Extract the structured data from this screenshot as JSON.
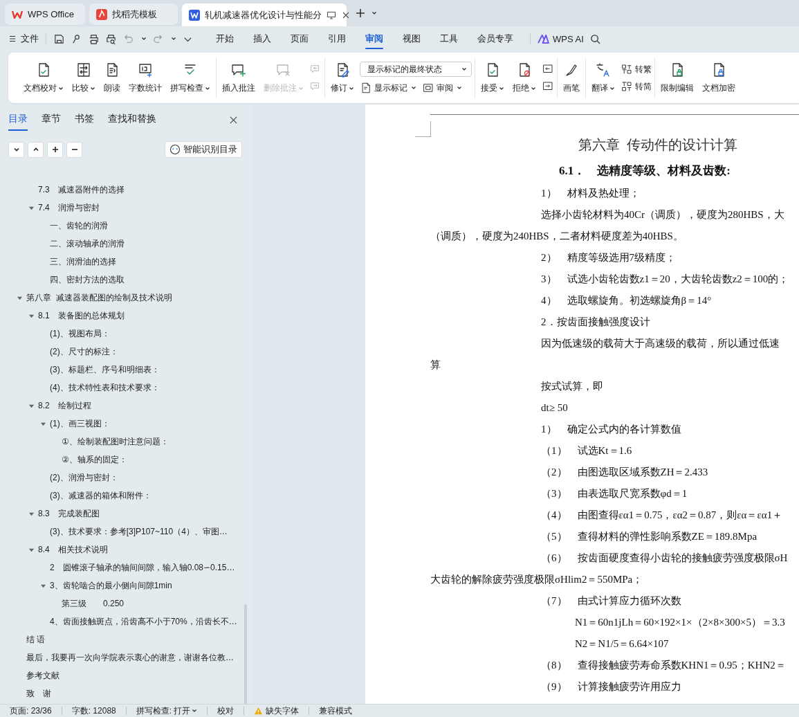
{
  "tabs": [
    {
      "title": "WPS Office",
      "selected": false,
      "kind": "home"
    },
    {
      "title": "找稻壳模板",
      "selected": false,
      "kind": "template"
    },
    {
      "title": "轧机减速器优化设计与性能分",
      "selected": true,
      "kind": "document"
    }
  ],
  "menu": {
    "file": "文件",
    "tabs": [
      {
        "label": "开始",
        "selected": false
      },
      {
        "label": "插入",
        "selected": false
      },
      {
        "label": "页面",
        "selected": false
      },
      {
        "label": "引用",
        "selected": false
      },
      {
        "label": "审阅",
        "selected": true
      },
      {
        "label": "视图",
        "selected": false
      },
      {
        "label": "工具",
        "selected": false
      },
      {
        "label": "会员专享",
        "selected": false
      }
    ],
    "ai": "WPS AI"
  },
  "ribbon": {
    "groups": [
      {
        "items": [
          {
            "kind": "large",
            "label": "文档校对",
            "dropdown": true,
            "disabled": false
          },
          {
            "kind": "large",
            "label": "比较",
            "dropdown": true,
            "disabled": false
          },
          {
            "kind": "large",
            "label": "朗读",
            "dropdown": false,
            "disabled": false
          },
          {
            "kind": "large",
            "label": "字数统计",
            "dropdown": false,
            "disabled": false
          },
          {
            "kind": "large",
            "label": "拼写检查",
            "dropdown": true,
            "disabled": false
          }
        ]
      },
      {
        "items": [
          {
            "kind": "large",
            "label": "插入批注",
            "dropdown": false,
            "disabled": false
          },
          {
            "kind": "large",
            "label": "删除批注",
            "dropdown": true,
            "disabled": true
          },
          {
            "kind": "stack",
            "rows": [
              [
                {
                  "kind": "icon",
                  "disabled": true
                }
              ],
              [
                {
                  "kind": "icon",
                  "disabled": true
                }
              ]
            ]
          }
        ]
      },
      {
        "items": [
          {
            "kind": "large",
            "label": "修订",
            "dropdown": true,
            "disabled": false
          },
          {
            "kind": "stack",
            "rows": [
              [
                {
                  "kind": "select",
                  "value": "显示标记的最终状态"
                }
              ],
              [
                {
                  "kind": "small",
                  "label": "显示标记",
                  "dropdown": true,
                  "disabled": false
                },
                {
                  "kind": "small",
                  "label": "审阅",
                  "dropdown": true,
                  "disabled": false
                }
              ]
            ]
          }
        ]
      },
      {
        "items": [
          {
            "kind": "large",
            "label": "接受",
            "dropdown": true,
            "disabled": false
          },
          {
            "kind": "large",
            "label": "拒绝",
            "dropdown": true,
            "disabled": false
          },
          {
            "kind": "stack",
            "rows": [
              [
                {
                  "kind": "icon",
                  "disabled": false
                }
              ],
              [
                {
                  "kind": "icon",
                  "disabled": false
                }
              ]
            ]
          }
        ]
      },
      {
        "items": [
          {
            "kind": "large",
            "label": "画笔",
            "dropdown": false,
            "disabled": false
          }
        ]
      },
      {
        "items": [
          {
            "kind": "large",
            "label": "翻译",
            "dropdown": true,
            "disabled": false
          },
          {
            "kind": "stack",
            "rows": [
              [
                {
                  "kind": "small",
                  "label": "转繁",
                  "dropdown": false,
                  "disabled": false
                }
              ],
              [
                {
                  "kind": "small",
                  "label": "转简",
                  "dropdown": false,
                  "disabled": false
                }
              ]
            ]
          }
        ]
      },
      {
        "items": [
          {
            "kind": "large",
            "label": "限制编辑",
            "dropdown": false,
            "disabled": false
          },
          {
            "kind": "large",
            "label": "文档加密",
            "dropdown": false,
            "disabled": false
          }
        ]
      }
    ]
  },
  "sidebar": {
    "tabs": [
      {
        "label": "目录",
        "selected": true
      },
      {
        "label": "章节",
        "selected": false
      },
      {
        "label": "书签",
        "selected": false
      },
      {
        "label": "查找和替换",
        "selected": false
      }
    ],
    "smart_button": "智能识别目录",
    "toc": {
      "partial_section": [
        {
          "text": "7.3　减速器附件的选择"
        },
        {
          "text": "7.4　润滑与密封",
          "expanded": true,
          "children": [
            {
              "text": "一、齿轮的润滑"
            },
            {
              "text": "二、滚动轴承的润滑"
            },
            {
              "text": "三、润滑油的选择"
            },
            {
              "text": "四、密封方法的选取"
            }
          ]
        }
      ],
      "items": [
        {
          "text": "第八章  减速器装配图的绘制及技术说明",
          "expanded": true,
          "children": [
            {
              "text": "8.1　装备图的总体规划",
              "expanded": true,
              "children": [
                {
                  "text": "(1)、视图布局："
                },
                {
                  "text": "(2)、尺寸的标注："
                },
                {
                  "text": "(3)、标题栏、序号和明细表："
                },
                {
                  "text": "(4)、技术特性表和技术要求："
                }
              ]
            },
            {
              "text": "8.2　绘制过程",
              "expanded": true,
              "children": [
                {
                  "text": "(1)、画三视图：",
                  "expanded": true,
                  "children": [
                    {
                      "text": "①、绘制装配图时注意问题："
                    },
                    {
                      "text": "②、轴系的固定："
                    }
                  ]
                },
                {
                  "text": "(2)、润滑与密封："
                },
                {
                  "text": "(3)、减速器的箱体和附件："
                }
              ]
            },
            {
              "text": "8.3　完成装配图",
              "expanded": true,
              "children": [
                {
                  "text": "(3)、技术要求：参考[3]P107~110（4）、审图…"
                }
              ]
            },
            {
              "text": "8.4　相关技术说明",
              "expanded": true,
              "children": [
                {
                  "text": "2　圆锥滚子轴承的轴间间隙，输入轴0.08∽0.15…"
                },
                {
                  "text": "3、齿轮啮合的最小侧向间隙1min",
                  "expanded": true,
                  "children": [
                    {
                      "text": "第三级　　0.250"
                    }
                  ]
                },
                {
                  "text": "4、齿面接触斑点，沿齿高不小于70%，沿齿长不…"
                }
              ]
            }
          ]
        },
        {
          "text": "结 语"
        },
        {
          "text": "最后，我要再一次向学院表示衷心的谢意，谢谢各位教…"
        },
        {
          "text": "参考文献"
        },
        {
          "text": "致　谢"
        }
      ]
    }
  },
  "document": {
    "lines": [
      {
        "kind": "chapter-title",
        "text": "第六章  传动件的设计计算"
      },
      {
        "kind": "section-heading",
        "text": "6.1．　选精度等级、材料及齿数:"
      },
      {
        "kind": "body",
        "text": "1）　材料及热处理；"
      },
      {
        "kind": "body",
        "text": "选择小齿轮材料为40Cr（调质），硬度为280HBS，大"
      },
      {
        "kind": "continuation",
        "text": "（调质），硬度为240HBS，二者材料硬度差为40HBS。"
      },
      {
        "kind": "body",
        "text": "2）　精度等级选用7级精度；"
      },
      {
        "kind": "body",
        "text": "3）　试选小齿轮齿数z1＝20，大齿轮齿数z2＝100的；"
      },
      {
        "kind": "body",
        "text": "4）　选取螺旋角。初选螺旋角β＝14°"
      },
      {
        "kind": "body",
        "text": "2．按齿面接触强度设计"
      },
      {
        "kind": "body",
        "text": "因为低速级的载荷大于高速级的载荷，所以通过低速"
      },
      {
        "kind": "continuation",
        "text": "算"
      },
      {
        "kind": "body",
        "text": "按式试算，即"
      },
      {
        "kind": "body",
        "text": "dt≥ 50"
      },
      {
        "kind": "body",
        "text": "1）　确定公式内的各计算数值"
      },
      {
        "kind": "body",
        "text": "（1）　试选Kt＝1.6"
      },
      {
        "kind": "body",
        "text": "（2）　由图选取区域系数ZH＝2.433"
      },
      {
        "kind": "body",
        "text": "（3）　由表选取尺宽系数φd＝1"
      },
      {
        "kind": "body",
        "text": "（4）　由图查得εα1＝0.75，εα2＝0.87，则εα＝εα1＋"
      },
      {
        "kind": "body",
        "text": "（5）　查得材料的弹性影响系数ZE＝189.8Mpa"
      },
      {
        "kind": "body",
        "text": "（6）　按齿面硬度查得小齿轮的接触疲劳强度极限σH"
      },
      {
        "kind": "continuation",
        "text": "大齿轮的解除疲劳强度极限σHlim2＝550MPa；"
      },
      {
        "kind": "body",
        "text": "（7）　由式计算应力循环次数"
      },
      {
        "kind": "formula",
        "text": "N1＝60n1jLh＝60×192×1×（2×8×300×5）＝3.3"
      },
      {
        "kind": "formula",
        "text": "N2＝N1/5＝6.64×107"
      },
      {
        "kind": "body",
        "text": "（8）　查得接触疲劳寿命系数KHN1＝0.95；KHN2＝"
      },
      {
        "kind": "body",
        "text": "（9）　计算接触疲劳许用应力"
      }
    ]
  },
  "status_bar": {
    "page": "页面: 23/36",
    "words": "字数: 12088",
    "spell": "拼写检查: 打开",
    "proof": "校对",
    "missing_font": "缺失字体",
    "compat": "兼容模式"
  }
}
